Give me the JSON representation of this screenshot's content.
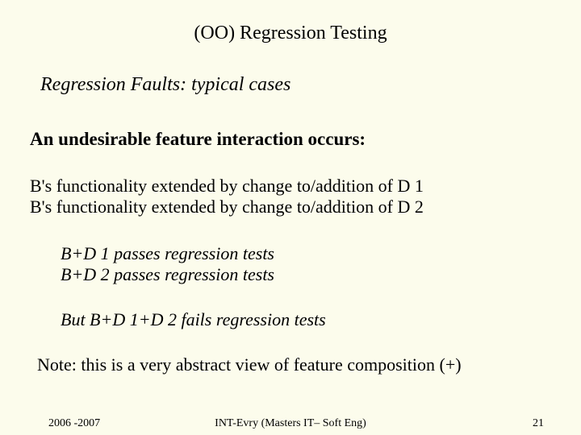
{
  "title": "(OO) Regression Testing",
  "subtitle": "Regression Faults: typical cases",
  "heading": "An undesirable feature interaction occurs:",
  "para1_line1": "B's functionality extended by change to/addition of D 1",
  "para1_line2": "B's functionality extended by change to/addition of D 2",
  "para2_line1": "B+D 1 passes regression tests",
  "para2_line2": "B+D 2 passes regression tests",
  "para3": "But B+D 1+D 2 fails regression tests",
  "note": "Note: this is a very abstract view of feature composition (+)",
  "footer": {
    "left": "2006 -2007",
    "center": "INT-Evry (Masters IT– Soft Eng)",
    "right": "21"
  }
}
